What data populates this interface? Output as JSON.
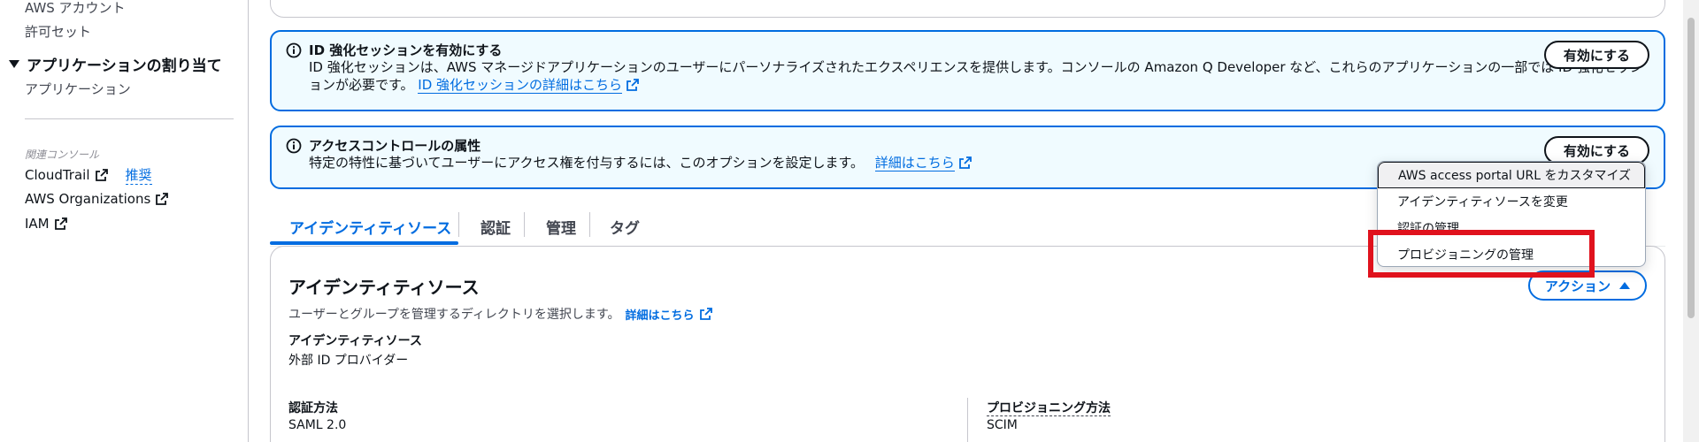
{
  "sidebar": {
    "items_top": [
      "AWS アカウント",
      "許可セット"
    ],
    "section_title": "アプリケーションの割り当て",
    "section_item": "アプリケーション",
    "related_label": "関連コンソール",
    "related": [
      {
        "label": "CloudTrail",
        "extra": "推奨"
      },
      {
        "label": "AWS Organizations"
      },
      {
        "label": "IAM"
      }
    ]
  },
  "flash1": {
    "title": "ID 強化セッションを有効にする",
    "line1": "ID 強化セッションは、AWS マネージドアプリケーションのユーザーにパーソナライズされたエクスペリエンスを提供します。コンソールの Amazon Q Developer など、これらのアプリケーションの一部では ID 強化セッシ",
    "line2": "ョンが必要です。",
    "link": "ID 強化セッションの詳細はこちら",
    "button": "有効にする"
  },
  "flash2": {
    "title": "アクセスコントロールの属性",
    "line1": "特定の特性に基づいてユーザーにアクセス権を付与するには、このオプションを設定します。",
    "link": "詳細はこちら",
    "button": "有効にする"
  },
  "tabs": [
    "アイデンティティソース",
    "認証",
    "管理",
    "タグ"
  ],
  "card": {
    "title": "アイデンティティソース",
    "description": "ユーザーとグループを管理するディレクトリを選択します。",
    "learn_more": "詳細はこちら",
    "fields": {
      "identity_source_label": "アイデンティティソース",
      "identity_source_value": "外部 ID プロバイダー",
      "auth_method_label": "認証方法",
      "auth_method_value": "SAML 2.0",
      "provisioning_label": "プロビジョニング方法",
      "provisioning_value": "SCIM"
    },
    "actions_label": "アクション"
  },
  "dropdown": {
    "items": [
      "AWS access portal URL をカスタマイズ",
      "アイデンティティソースを変更",
      "認証の管理",
      "プロビジョニングの管理"
    ]
  },
  "colors": {
    "accent": "#006ce0",
    "info_bg": "#f0fbff",
    "highlight": "#e0121d"
  }
}
